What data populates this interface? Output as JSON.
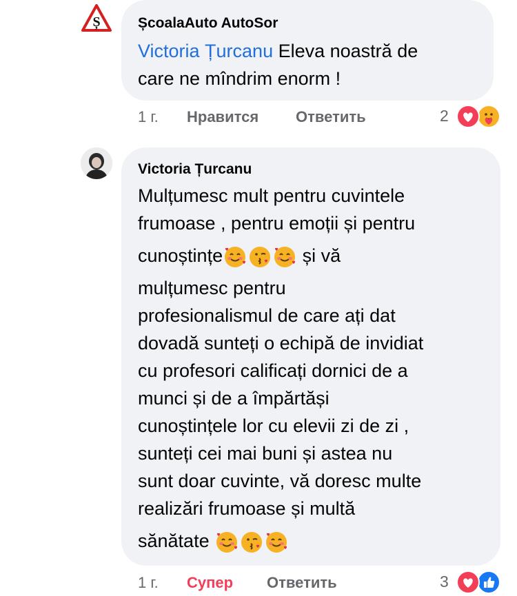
{
  "comments": [
    {
      "author": "ȘcoalaAuto AutoSor",
      "mention": "Victoria Țurcanu",
      "text_a": "  Eleva noastră de",
      "text_b": "care ne mîndrim enorm !",
      "time": "1 г.",
      "like_label": "Нравится",
      "reply_label": "Ответить",
      "reaction_count": "2",
      "reactions": [
        "love-icon",
        "care-icon"
      ],
      "avatar_letter": "Ș"
    },
    {
      "author": "Victoria Țurcanu",
      "lines": [
        "Mulțumesc mult pentru cuvintele",
        "frumoase  , pentru emoții și pentru",
        "cunoștințe",
        " și vă",
        "mulțumesc pentru",
        "profesionalismul de care ați dat",
        "dovadă sunteți o echipă de invidiat",
        "cu profesori calificați dornici de a",
        "munci și de a împărtăși",
        "cunoștințele lor cu elevii zi de zi ,",
        "sunteți cei mai buni și astea nu",
        "sunt doar cuvinte, vă doresc multe",
        "realizări frumoase și multă",
        "sănătate "
      ],
      "emojis": [
        "smiling-face-with-hearts-emoji",
        "face-blowing-kiss-emoji",
        "smiling-face-with-hearts-emoji"
      ],
      "time": "1 г.",
      "reaction_label": "Супер",
      "reply_label": "Ответить",
      "reaction_count": "3",
      "reactions": [
        "love-icon",
        "like-icon"
      ]
    }
  ],
  "colors": {
    "bubble": "#f0f2f5",
    "mention": "#216fdb",
    "meta": "#65676b",
    "super": "#f33e58",
    "like": "#1877f2"
  }
}
